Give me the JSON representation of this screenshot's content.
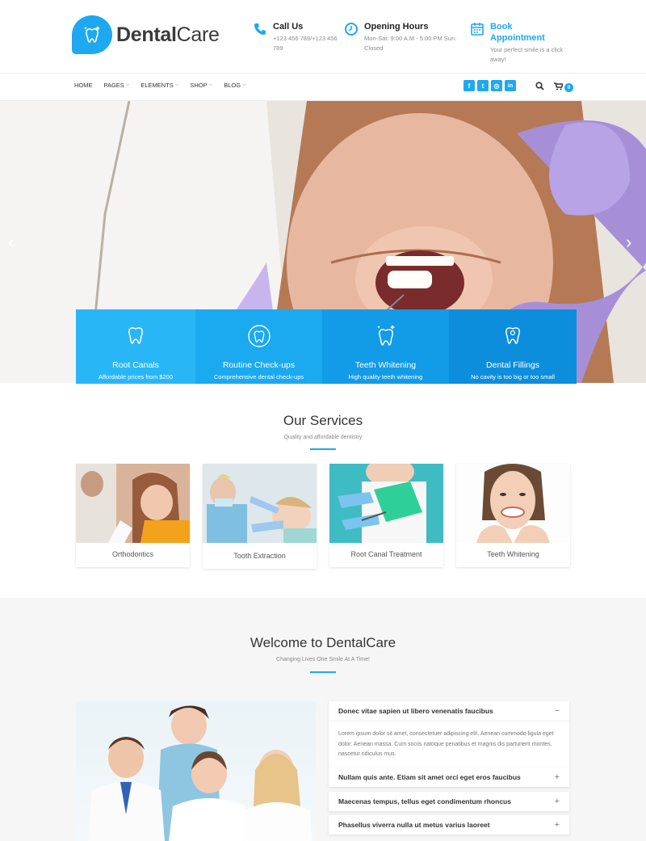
{
  "brand": {
    "name_bold": "Dental",
    "name_light": "Care",
    "color": "#1ea8f0"
  },
  "header": {
    "call": {
      "title": "Call Us",
      "line1": "+123 456 789/+123 456",
      "line2": "789",
      "icon": "phone-icon"
    },
    "hours": {
      "title": "Opening Hours",
      "line1": "Mon-Sat: 9:00 A.M - 5:00 PM Sun:",
      "line2": "Closed",
      "icon": "clock-icon"
    },
    "book": {
      "title_line1": "Book",
      "title_line2": "Appointment",
      "line1": "Your perfect smile is a click",
      "line2": "away!",
      "icon": "calendar-icon"
    }
  },
  "nav": {
    "items": [
      {
        "label": "HOME",
        "dropdown": false
      },
      {
        "label": "PAGES",
        "dropdown": true
      },
      {
        "label": "ELEMENTS",
        "dropdown": true
      },
      {
        "label": "SHOP",
        "dropdown": true
      },
      {
        "label": "BLOG",
        "dropdown": true
      }
    ],
    "socials": [
      {
        "icon": "facebook-icon",
        "glyph": "f"
      },
      {
        "icon": "twitter-icon",
        "glyph": "t"
      },
      {
        "icon": "instagram-icon",
        "glyph": "◎"
      },
      {
        "icon": "linkedin-icon",
        "glyph": "in"
      }
    ],
    "cart_count": "0"
  },
  "features": [
    {
      "title": "Root Canals",
      "sub": "Affordable prices from $200",
      "color": "#29b6f6",
      "icon": "tooth-icon"
    },
    {
      "title": "Routine Check-ups",
      "sub": "Comprehensive dental check-ups",
      "color": "#1ba9ef",
      "icon": "tooth-checkup-icon"
    },
    {
      "title": "Teeth Whitening",
      "sub": "High quality teeth whitening",
      "color": "#129be6",
      "icon": "tooth-sparkle-icon"
    },
    {
      "title": "Dental Fillings",
      "sub": "No cavity is too big or too small",
      "color": "#0d8edc",
      "icon": "tooth-filling-icon"
    }
  ],
  "services": {
    "title": "Our Services",
    "subtitle": "Quality and affordable dentistry",
    "items": [
      {
        "label": "Orthodontics"
      },
      {
        "label": "Tooth Extraction"
      },
      {
        "label": "Root Canal Treatment"
      },
      {
        "label": "Teeth Whitening"
      }
    ]
  },
  "welcome": {
    "title": "Welcome to DentalCare",
    "subtitle": "Changing Lives One Smile At A Time!",
    "accordion": [
      {
        "title": "Donec vitae sapien ut libero venenatis faucibus",
        "sign": "−",
        "open": true,
        "body": "Lorem ipsum dolor sit amet, consectetuer adipiscing elit. Aenean commodo ligula eget dolor. Aenean massa. Cum sociis natoque penatibus et magnis dis parturient montes, nascetur ridiculus mus."
      },
      {
        "title": "Nullam quis ante. Etiam sit amet orci eget eros faucibus",
        "sign": "+",
        "open": false
      },
      {
        "title": "Maecenas tempus, tellus eget condimentum rhoncus",
        "sign": "+",
        "open": false
      },
      {
        "title": "Phasellus viverra nulla ut metus varius laoreet",
        "sign": "+",
        "open": false
      }
    ]
  }
}
